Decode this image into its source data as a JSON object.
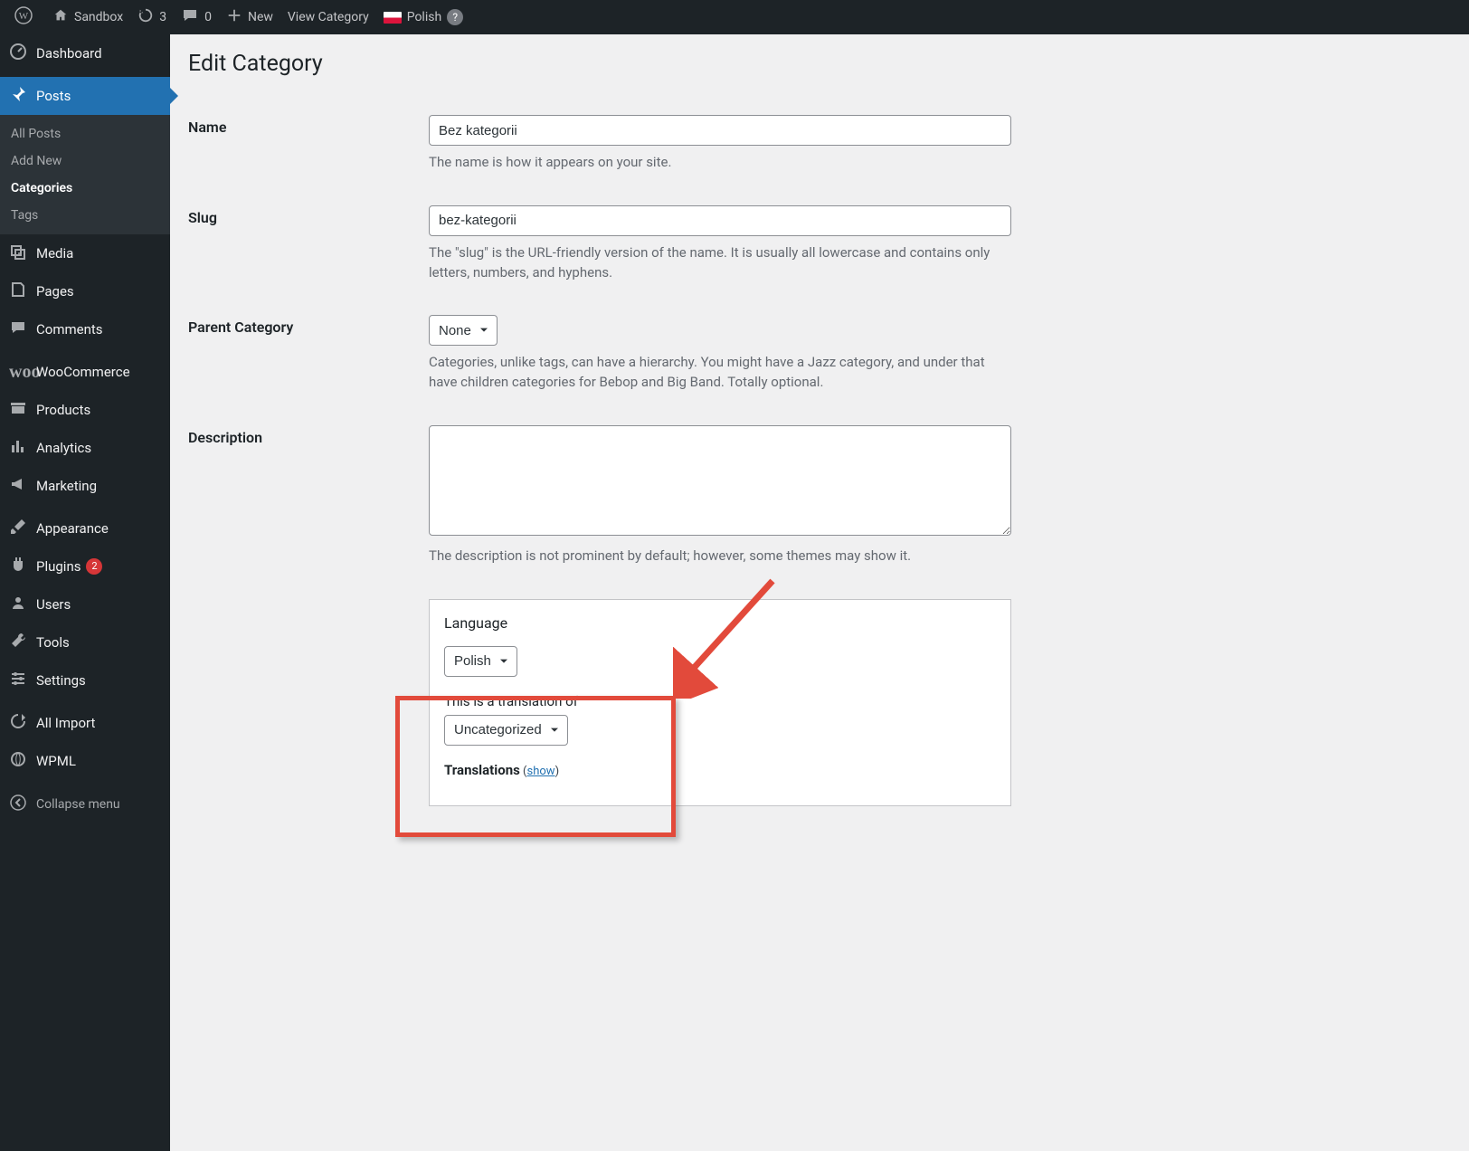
{
  "adminbar": {
    "site_title": "Sandbox",
    "updates": "3",
    "comments": "0",
    "new_label": "New",
    "view_label": "View Category",
    "lang_label": "Polish"
  },
  "menu": {
    "dashboard": "Dashboard",
    "posts": "Posts",
    "posts_sub": {
      "all": "All Posts",
      "add": "Add New",
      "cats": "Categories",
      "tags": "Tags"
    },
    "media": "Media",
    "pages": "Pages",
    "comments": "Comments",
    "woo": "WooCommerce",
    "products": "Products",
    "analytics": "Analytics",
    "marketing": "Marketing",
    "appearance": "Appearance",
    "plugins": "Plugins",
    "plugins_badge": "2",
    "users": "Users",
    "tools": "Tools",
    "settings": "Settings",
    "allimport": "All Import",
    "wpml": "WPML",
    "collapse": "Collapse menu"
  },
  "page": {
    "title": "Edit Category",
    "name_label": "Name",
    "name_value": "Bez kategorii",
    "name_help": "The name is how it appears on your site.",
    "slug_label": "Slug",
    "slug_value": "bez-kategorii",
    "slug_help": "The \"slug\" is the URL-friendly version of the name. It is usually all lowercase and contains only letters, numbers, and hyphens.",
    "parent_label": "Parent Category",
    "parent_value": "None",
    "parent_help": "Categories, unlike tags, can have a hierarchy. You might have a Jazz category, and under that have children categories for Bebop and Big Band. Totally optional.",
    "desc_label": "Description",
    "desc_help": "The description is not prominent by default; however, some themes may show it.",
    "lang": {
      "heading": "Language",
      "select_value": "Polish",
      "translation_of_label": "This is a translation of",
      "translation_select": "Uncategorized",
      "translations_label": "Translations",
      "show": "show"
    }
  }
}
